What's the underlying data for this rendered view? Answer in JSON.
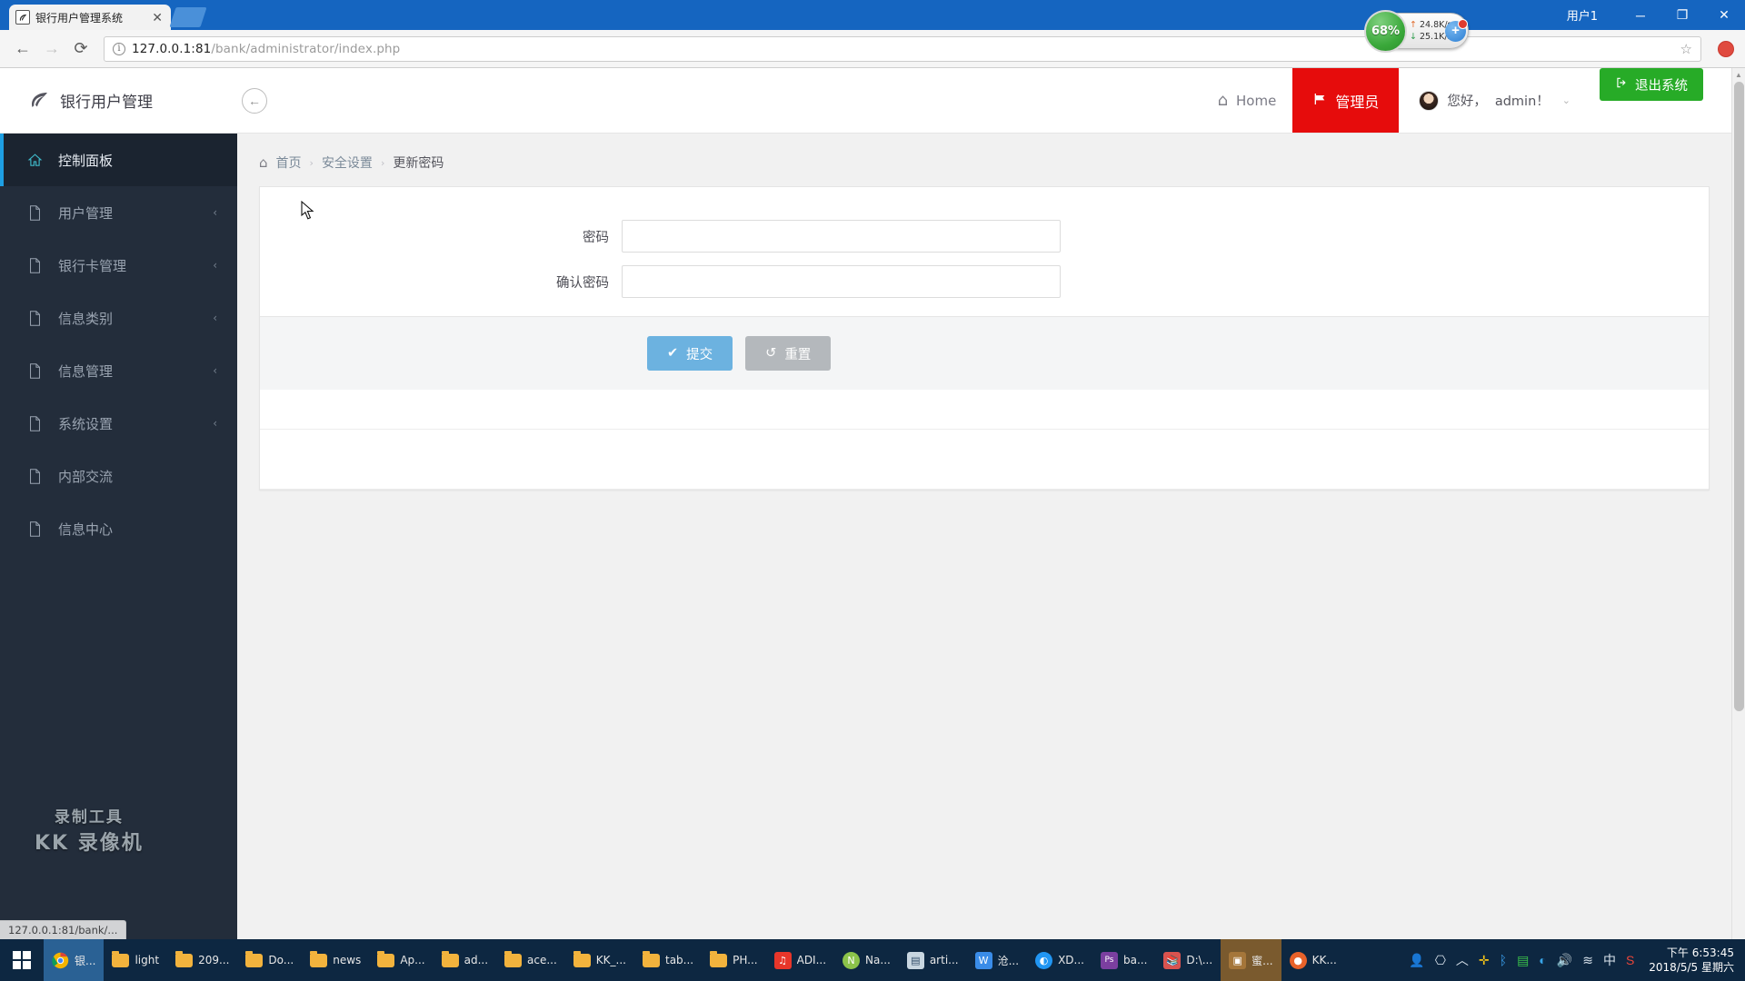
{
  "browser": {
    "tab": {
      "title": "银行用户管理系统",
      "favicon_icon": "leaf-favicon",
      "close_icon": "close-icon"
    },
    "new_tab_icon": "new-tab-icon",
    "window": {
      "user_label": "用户1",
      "minimize_icon": "minimize-icon",
      "maximize_icon": "maximize-icon",
      "close_icon": "close-icon"
    },
    "nav": {
      "back_icon": "back-arrow-icon",
      "forward_icon": "forward-arrow-icon",
      "reload_icon": "reload-icon",
      "info_icon": "info-icon",
      "url_host": "127.0.0.1:81",
      "url_path": "/bank/administrator/index.php",
      "star_icon": "star-icon",
      "profile_icon": "profile-avatar-icon"
    },
    "speed_widget": {
      "percent": "68%",
      "upload": "24.8K/s",
      "download": "25.1K/s",
      "up_arrow": "▲",
      "down_arrow": "▼",
      "plus_icon": "add-icon"
    },
    "status_text": "127.0.0.1:81/bank/..."
  },
  "app_header": {
    "logo_icon": "leaf-logo-icon",
    "brand": "银行用户管理",
    "collapse_icon": "collapse-left-icon",
    "home_label": "Home",
    "home_icon": "home-icon",
    "admin_tab_label": "管理员",
    "admin_tab_icon": "flag-icon",
    "greeting": "您好，",
    "username": "admin！",
    "user_chevron_icon": "chevron-down-icon",
    "avatar_icon": "user-avatar",
    "logout_label": "退出系统",
    "logout_icon": "sign-out-icon"
  },
  "sidebar": {
    "items": [
      {
        "label": "控制面板",
        "icon": "home-outline-icon",
        "active": true,
        "chevron": false
      },
      {
        "label": "用户管理",
        "icon": "file-icon",
        "active": false,
        "chevron": true
      },
      {
        "label": "银行卡管理",
        "icon": "file-icon",
        "active": false,
        "chevron": true
      },
      {
        "label": "信息类别",
        "icon": "file-icon",
        "active": false,
        "chevron": true
      },
      {
        "label": "信息管理",
        "icon": "file-icon",
        "active": false,
        "chevron": true
      },
      {
        "label": "系统设置",
        "icon": "file-icon",
        "active": false,
        "chevron": true
      },
      {
        "label": "内部交流",
        "icon": "file-icon",
        "active": false,
        "chevron": false
      },
      {
        "label": "信息中心",
        "icon": "file-icon",
        "active": false,
        "chevron": false
      }
    ],
    "watermark_line1": "录制工具",
    "watermark_line2": "KK 录像机"
  },
  "breadcrumb": {
    "home_icon": "home-icon",
    "home": "首页",
    "sep": "›",
    "level2": "安全设置",
    "current": "更新密码"
  },
  "form": {
    "fields": [
      {
        "label": "密码",
        "value": "",
        "placeholder": "",
        "name": "password-field"
      },
      {
        "label": "确认密码",
        "value": "",
        "placeholder": "",
        "name": "confirm-password-field"
      }
    ],
    "submit_label": "提交",
    "submit_icon": "check-icon",
    "reset_label": "重置",
    "reset_icon": "undo-icon"
  },
  "scrollbar": {
    "up_icon": "caret-up-icon",
    "down_icon": "caret-down-icon"
  },
  "taskbar": {
    "start_icon": "windows-start-icon",
    "items": [
      {
        "label": "银...",
        "icon": "chrome-icon",
        "state": "active"
      },
      {
        "label": "light",
        "icon": "folder-icon",
        "state": ""
      },
      {
        "label": "209...",
        "icon": "folder-icon",
        "state": ""
      },
      {
        "label": "Do...",
        "icon": "folder-icon",
        "state": ""
      },
      {
        "label": "news",
        "icon": "folder-icon",
        "state": ""
      },
      {
        "label": "Ap...",
        "icon": "folder-icon",
        "state": ""
      },
      {
        "label": "ad...",
        "icon": "folder-icon",
        "state": ""
      },
      {
        "label": "ace...",
        "icon": "folder-icon",
        "state": ""
      },
      {
        "label": "KK_...",
        "icon": "folder-icon",
        "state": ""
      },
      {
        "label": "tab...",
        "icon": "folder-icon",
        "state": ""
      },
      {
        "label": "PH...",
        "icon": "folder-icon",
        "state": ""
      },
      {
        "label": "ADI...",
        "icon": "netease-music-icon",
        "state": ""
      },
      {
        "label": "Na...",
        "icon": "navicat-icon",
        "state": ""
      },
      {
        "label": "arti...",
        "icon": "app-icon",
        "state": ""
      },
      {
        "label": "沧...",
        "icon": "wps-writer-icon",
        "state": ""
      },
      {
        "label": "XD...",
        "icon": "sogou-icon",
        "state": ""
      },
      {
        "label": "ba...",
        "icon": "photoshop-icon",
        "state": ""
      },
      {
        "label": "D:\\...",
        "icon": "books-icon",
        "state": ""
      },
      {
        "label": "蜜...",
        "icon": "image-icon",
        "state": "active2"
      },
      {
        "label": "KK...",
        "icon": "kk-recorder-icon",
        "state": ""
      }
    ],
    "tray_icons": [
      "people-icon",
      "usb-eject-icon",
      "show-hidden-icon",
      "shield-green-icon",
      "bluetooth-icon",
      "notepad-icon",
      "sogou-globe-icon",
      "volume-icon",
      "wifi-icon",
      "ime-chinese-icon",
      "sogou-s-icon"
    ],
    "clock_time": "下午 6:53:45",
    "clock_date": "2018/5/5 星期六"
  }
}
